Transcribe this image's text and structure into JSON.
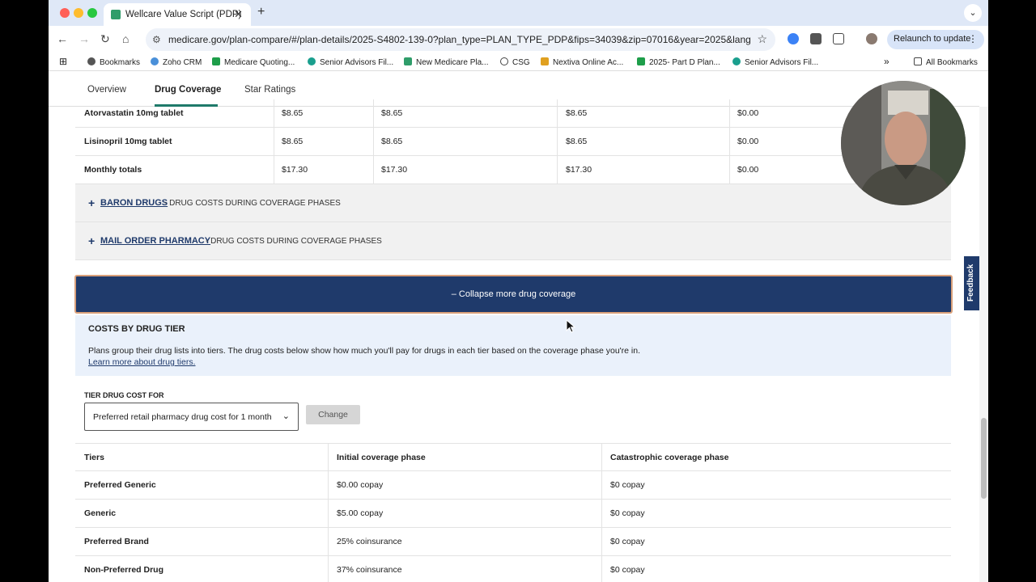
{
  "browser": {
    "tab_title": "Wellcare Value Script (PDP)",
    "tab_close": "✕",
    "new_tab": "+",
    "tab_menu": "⌄",
    "url": "medicare.gov/plan-compare/#/plan-details/2025-S4802-139-0?plan_type=PLAN_TYPE_PDP&fips=34039&zip=07016&year=2025&lang=e...",
    "relaunch": "Relaunch to update",
    "back": "←",
    "forward": "→",
    "reload": "↻",
    "home": "⌂",
    "star": "☆",
    "more": "⋮",
    "site_info": "⚙"
  },
  "bookmarks": {
    "apps": "⊞",
    "overflow": "»",
    "all": "All Bookmarks",
    "items": [
      "Bookmarks",
      "Zoho CRM",
      "Medicare Quoting...",
      "Senior Advisors Fil...",
      "New Medicare Pla...",
      "CSG",
      "Nextiva Online Ac...",
      "2025- Part D Plan...",
      "Senior Advisors Fil..."
    ]
  },
  "page_tabs": [
    "Overview",
    "Drug Coverage",
    "Star Ratings"
  ],
  "drug_rows": [
    {
      "name": "Atorvastatin 10mg tablet",
      "c1": "$8.65",
      "c2": "$8.65",
      "c3": "$8.65",
      "c4": "$0.00"
    },
    {
      "name": "Lisinopril 10mg tablet",
      "c1": "$8.65",
      "c2": "$8.65",
      "c3": "$8.65",
      "c4": "$0.00"
    },
    {
      "name": "Monthly totals",
      "c1": "$17.30",
      "c2": "$17.30",
      "c3": "$17.30",
      "c4": "$0.00"
    }
  ],
  "expanders": [
    {
      "link": "BARON DRUGS",
      "desc": "- DRUG COSTS DURING COVERAGE PHASES"
    },
    {
      "link": "MAIL ORDER PHARMACY",
      "desc": "- DRUG COSTS DURING COVERAGE PHASES"
    }
  ],
  "collapse_label": "–  Collapse more drug coverage",
  "tier_info": {
    "heading": "COSTS BY DRUG TIER",
    "text": "Plans group their drug lists into tiers. The drug costs below show how much you'll pay for drugs in each tier based on the coverage phase you're in.",
    "link": "Learn more about drug tiers."
  },
  "tier_for_label": "TIER DRUG COST FOR",
  "tier_select_value": "Preferred retail pharmacy drug cost for 1 month",
  "change_button": "Change",
  "tier_table": {
    "headers": [
      "Tiers",
      "Initial coverage phase",
      "Catastrophic coverage phase"
    ],
    "rows": [
      [
        "Preferred Generic",
        "$0.00 copay",
        "$0 copay"
      ],
      [
        "Generic",
        "$5.00 copay",
        "$0 copay"
      ],
      [
        "Preferred Brand",
        "25% coinsurance",
        "$0 copay"
      ],
      [
        "Non-Preferred Drug",
        "37% coinsurance",
        "$0 copay"
      ]
    ]
  },
  "feedback": "Feedback",
  "colors": {
    "navy": "#1f3a6b",
    "teal": "#1f7a6a",
    "tier_bg": "#eaf1fb"
  }
}
